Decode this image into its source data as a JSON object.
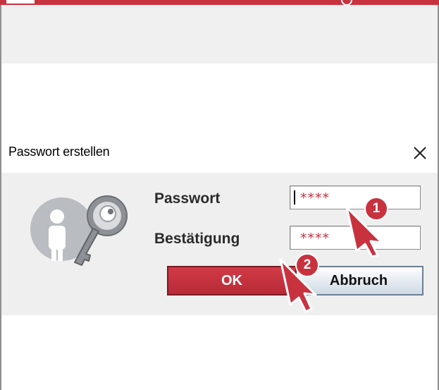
{
  "dialog": {
    "title": "Passwort erstellen",
    "password_label": "Passwort",
    "password_value": "****",
    "confirm_label": "Bestätigung",
    "confirm_value": "****",
    "ok_label": "OK",
    "cancel_label": "Abbruch"
  },
  "annotations": {
    "step1": "1",
    "step2": "2"
  },
  "icons": {
    "close": "close-icon",
    "dialog": "user-key-icon",
    "pointer": "cursor-arrow-icon"
  },
  "colors": {
    "accent": "#c8323f",
    "dialog_bg": "#efefef"
  }
}
